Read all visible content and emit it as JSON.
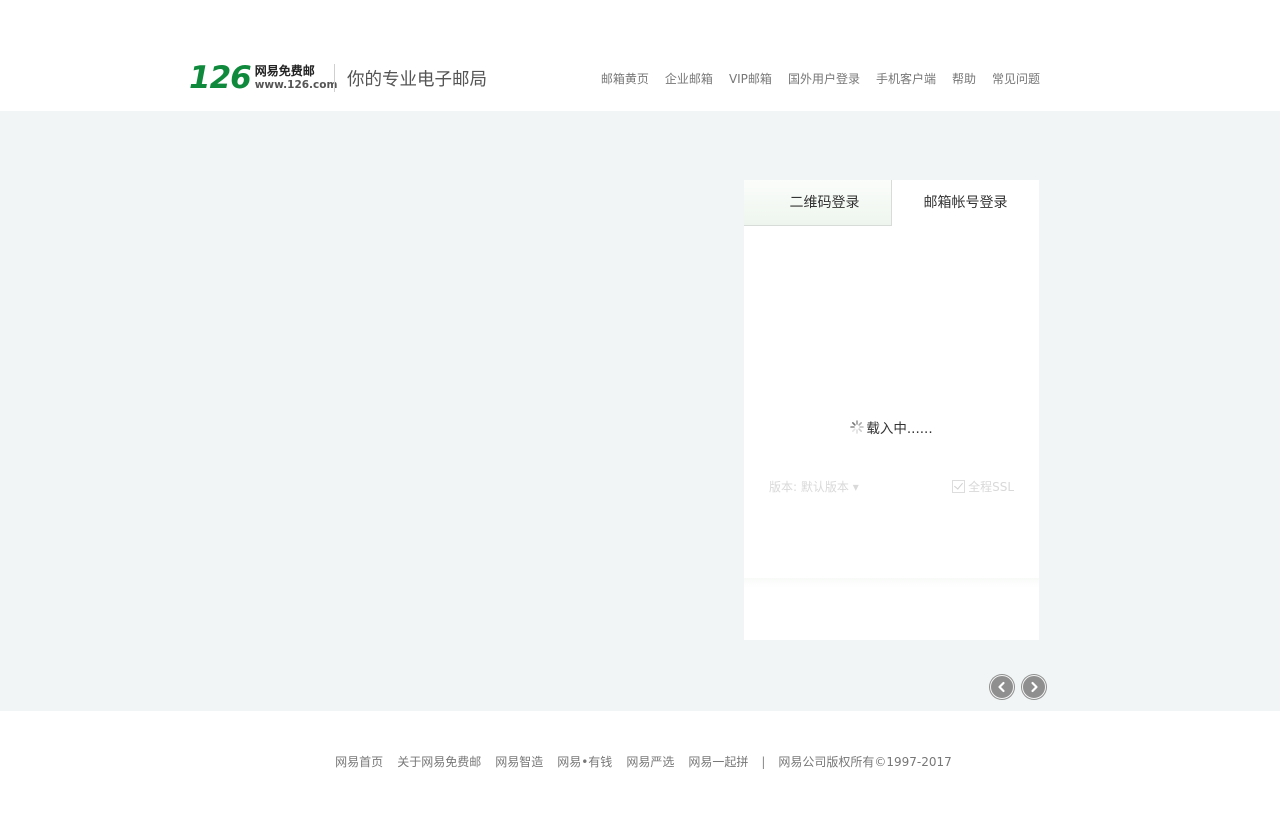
{
  "header": {
    "logo": {
      "number": "126",
      "name": "网易免费邮",
      "url": "www.126.com"
    },
    "slogan": "你的专业电子邮局",
    "nav": [
      "邮箱黄页",
      "企业邮箱",
      "VIP邮箱",
      "国外用户登录",
      "手机客户端",
      "帮助",
      "常见问题"
    ]
  },
  "login": {
    "tabs": {
      "qr": "二维码登录",
      "account": "邮箱帐号登录"
    },
    "active_tab": "邮箱帐号登录",
    "loading_text": "载入中......",
    "version_label": "版本: 默认版本",
    "ssl_label": "全程SSL",
    "ssl_checked": true
  },
  "carousel": {
    "prev_icon": "chevron-left-icon",
    "next_icon": "chevron-right-icon"
  },
  "footer": {
    "links": [
      "网易首页",
      "关于网易免费邮",
      "网易智造",
      "网易•有钱",
      "网易严选",
      "网易一起拼"
    ],
    "separator": "|",
    "copyright": "网易公司版权所有©1997-2017"
  },
  "colors": {
    "brand_green": "#0f8a3c",
    "main_bg": "#f1f5f5",
    "link_gray": "#777777"
  }
}
